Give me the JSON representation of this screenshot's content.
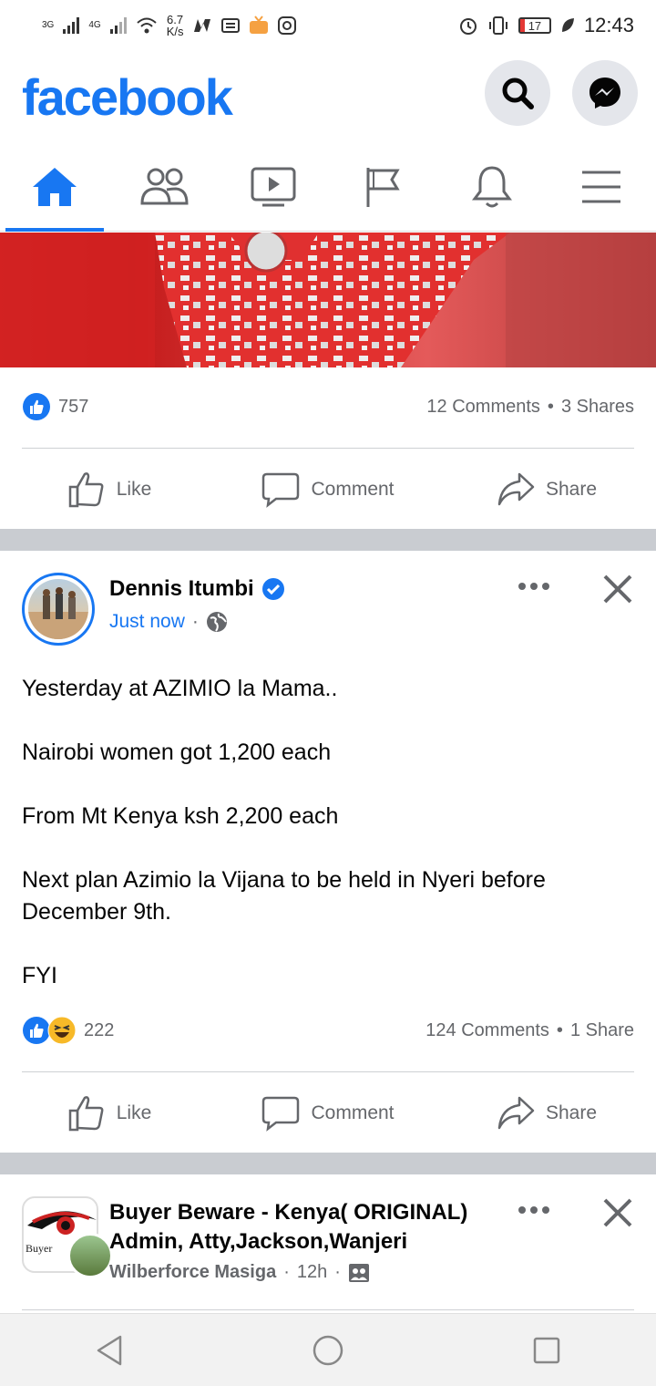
{
  "status_bar": {
    "net1": "3G",
    "net2": "4G",
    "speed_value": "6.7",
    "speed_unit": "K/s",
    "battery_level": "17",
    "time": "12:43"
  },
  "header": {
    "logo": "facebook"
  },
  "tabs": [
    {
      "name": "home",
      "active": true
    },
    {
      "name": "friends",
      "active": false
    },
    {
      "name": "watch",
      "active": false
    },
    {
      "name": "pages",
      "active": false
    },
    {
      "name": "notifications",
      "active": false
    },
    {
      "name": "menu",
      "active": false
    }
  ],
  "post1": {
    "reaction_count": "757",
    "comments": "12 Comments",
    "shares": "3 Shares",
    "like_label": "Like",
    "comment_label": "Comment",
    "share_label": "Share"
  },
  "post2": {
    "author": "Dennis Itumbi",
    "time": "Just now",
    "text": "Yesterday at AZIMIO la Mama..\n\nNairobi women got 1,200 each\n\nFrom Mt Kenya ksh 2,200 each\n\nNext plan Azimio la Vijana to be held in Nyeri before December 9th.\n\nFYI",
    "reaction_count": "222",
    "comments": "124 Comments",
    "shares": "1 Share",
    "like_label": "Like",
    "comment_label": "Comment",
    "share_label": "Share"
  },
  "post3": {
    "group_title": "Buyer Beware - Kenya( ORIGINAL) Admin, Atty,Jackson,Wanjeri",
    "poster": "Wilberforce Masiga",
    "time": "12h",
    "avatar_text": "Buyer"
  },
  "colors": {
    "brand": "#1877f2",
    "muted": "#65676b",
    "separator": "#c9ccd1"
  }
}
